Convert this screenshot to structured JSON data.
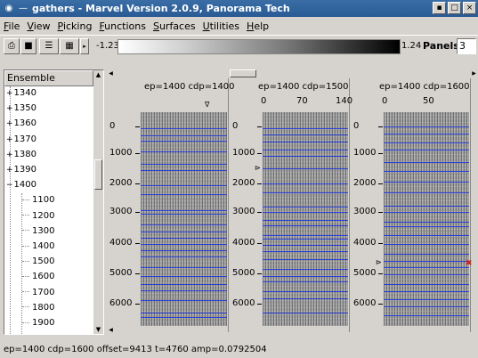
{
  "window": {
    "title": "gathers - Marvel Version 2.0.9, Panorama Tech",
    "buttons": [
      "▪",
      "□",
      "×"
    ]
  },
  "menu": [
    {
      "label": "File",
      "ul": "F",
      "rest": "ile"
    },
    {
      "label": "View",
      "ul": "V",
      "rest": "iew"
    },
    {
      "label": "Picking",
      "ul": "P",
      "rest": "icking"
    },
    {
      "label": "Functions",
      "ul": "F",
      "rest": "unctions"
    },
    {
      "label": "Surfaces",
      "ul": "S",
      "rest": "urfaces"
    },
    {
      "label": "Utilities",
      "ul": "U",
      "rest": "tilities"
    },
    {
      "label": "Help",
      "ul": "H",
      "rest": "elp"
    }
  ],
  "toolbar": {
    "color_min": "-1.23",
    "color_max": "1.24",
    "panels_label": "Panels:",
    "panels_value": "3"
  },
  "sidebar": {
    "header": "Ensemble",
    "items": [
      {
        "label": "1340",
        "prefix": "+"
      },
      {
        "label": "1350",
        "prefix": "+"
      },
      {
        "label": "1360",
        "prefix": "+"
      },
      {
        "label": "1370",
        "prefix": "+"
      },
      {
        "label": "1380",
        "prefix": "+"
      },
      {
        "label": "1390",
        "prefix": "+"
      },
      {
        "label": "1400",
        "prefix": "−"
      },
      {
        "label": "1100",
        "prefix": ""
      },
      {
        "label": "1200",
        "prefix": ""
      },
      {
        "label": "1300",
        "prefix": ""
      },
      {
        "label": "1400",
        "prefix": ""
      },
      {
        "label": "1500",
        "prefix": ""
      },
      {
        "label": "1600",
        "prefix": ""
      },
      {
        "label": "1700",
        "prefix": ""
      },
      {
        "label": "1800",
        "prefix": ""
      },
      {
        "label": "1900",
        "prefix": ""
      }
    ]
  },
  "panels": [
    {
      "title": "ep=1400 cdp=1400",
      "x_ticks": [],
      "y_ticks": [
        "0",
        "1000",
        "2000",
        "3000",
        "4000",
        "5000",
        "6000"
      ]
    },
    {
      "title": "ep=1400 cdp=1500",
      "x_ticks": [
        "0",
        "70",
        "140"
      ],
      "y_ticks": [
        "0",
        "1000",
        "2000",
        "3000",
        "4000",
        "5000",
        "6000"
      ]
    },
    {
      "title": "ep=1400 cdp=1600",
      "x_ticks": [
        "0",
        "50"
      ],
      "y_ticks": [
        "0",
        "1000",
        "2000",
        "3000",
        "4000",
        "5000",
        "6000"
      ]
    }
  ],
  "status": {
    "text": "ep=1400 cdp=1600  offset=9413 t=4760 amp=0.0792504"
  },
  "colors": {
    "titlebar": "#2a5a94",
    "horizon_line": "#2a3fd8",
    "pick_marker": "#d02020"
  }
}
